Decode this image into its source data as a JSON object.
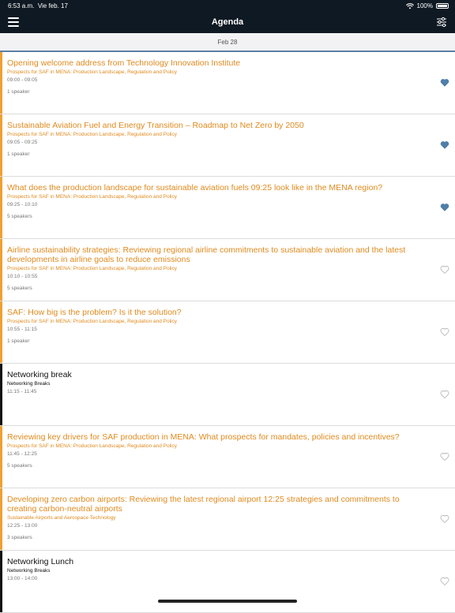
{
  "status": {
    "time": "6:53 a.m.",
    "date": "Vie feb. 17",
    "battery": "100%"
  },
  "nav": {
    "title": "Agenda"
  },
  "date_header": "Feb 28",
  "colors": {
    "accent": "#e08a1e",
    "nav_bg": "#0f1923",
    "heart_filled": "#4f7fa8",
    "heart_empty": "#b0b0b0"
  },
  "sessions": [
    {
      "title": "Opening welcome address from Technology Innovation Institute",
      "track": "Prospects for SAF in MENA: Production Landscape, Regulation and Policy",
      "time": "09:00 - 09:05",
      "speakers": "1 speaker",
      "favorite": true
    },
    {
      "title": "Sustainable Aviation Fuel and Energy Transition – Roadmap to Net Zero by 2050",
      "track": "Prospects for SAF in MENA: Production Landscape, Regulation and Policy",
      "time": "09:05 - 09:25",
      "speakers": "1 speaker",
      "favorite": true
    },
    {
      "title": "What does the production landscape for sustainable aviation fuels 09:25 look like in the MENA region?",
      "track": "Prospects for SAF in MENA: Production Landscape, Regulation and Policy",
      "time": "09:25 - 10:10",
      "speakers": "5 speakers",
      "favorite": true
    },
    {
      "title": "Airline sustainability strategies: Reviewing regional airline commitments to sustainable aviation and the latest developments in airline goals to reduce emissions",
      "track": "Prospects for SAF in MENA: Production Landscape, Regulation and Policy",
      "time": "10:10 - 10:55",
      "speakers": "5 speakers",
      "favorite": false
    },
    {
      "title": "SAF: How big is the problem? Is it the solution?",
      "track": "Prospects for SAF in MENA: Production Landscape, Regulation and Policy",
      "time": "10:55 - 11:15",
      "speakers": "1 speaker",
      "favorite": false
    },
    {
      "title": "Networking break",
      "track": "Networking Breaks",
      "time": "11:15 - 11:45",
      "speakers": "",
      "favorite": false,
      "break": true
    },
    {
      "title": "Reviewing key drivers for SAF production in MENA: What prospects for mandates, policies and incentives?",
      "track": "Prospects for SAF in MENA: Production Landscape, Regulation and Policy",
      "time": "11:45 - 12:25",
      "speakers": "5 speakers",
      "favorite": false
    },
    {
      "title": "Developing zero carbon airports: Reviewing the latest regional airport 12:25 strategies and commitments to creating carbon-neutral airports",
      "track": "Sustainable Airports and Aerospace Technology",
      "time": "12:25 - 13:00",
      "speakers": "3 speakers",
      "favorite": false
    },
    {
      "title": "Networking Lunch",
      "track": "Networking Breaks",
      "time": "13:00 - 14:00",
      "speakers": "",
      "favorite": false,
      "break": true
    }
  ]
}
